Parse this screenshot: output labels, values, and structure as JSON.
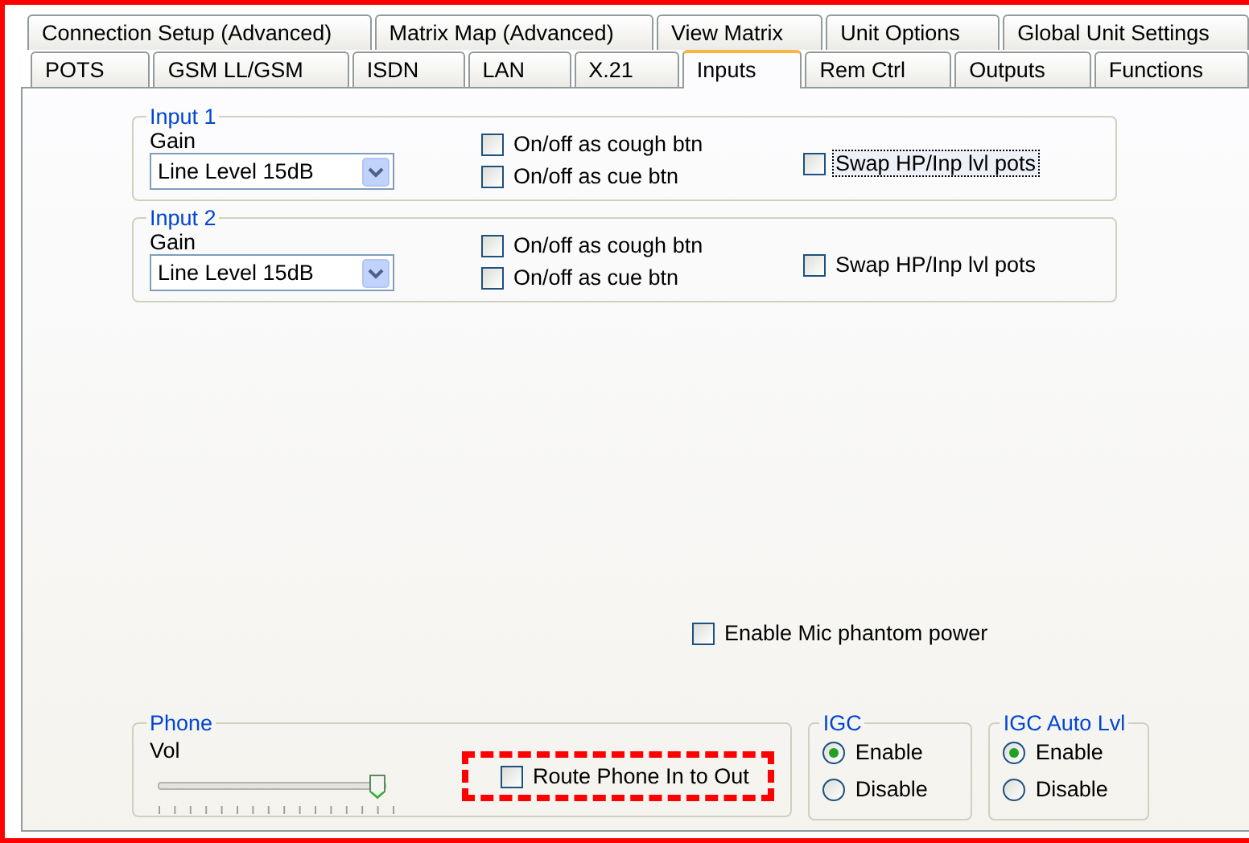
{
  "tab_rows": [
    [
      {
        "label": "Connection Setup (Advanced)",
        "selected": false
      },
      {
        "label": "Matrix Map (Advanced)",
        "selected": false
      },
      {
        "label": "View Matrix",
        "selected": false
      },
      {
        "label": "Unit Options",
        "selected": false
      },
      {
        "label": "Global Unit Settings",
        "selected": false
      }
    ],
    [
      {
        "label": "POTS",
        "selected": false
      },
      {
        "label": "GSM LL/GSM",
        "selected": false
      },
      {
        "label": "ISDN",
        "selected": false
      },
      {
        "label": "LAN",
        "selected": false
      },
      {
        "label": "X.21",
        "selected": false
      },
      {
        "label": "Inputs",
        "selected": true
      },
      {
        "label": "Rem Ctrl",
        "selected": false
      },
      {
        "label": "Outputs",
        "selected": false
      },
      {
        "label": "Functions",
        "selected": false
      }
    ]
  ],
  "input_groups": [
    {
      "title": "Input 1",
      "gain_label": "Gain",
      "gain_value": "Line Level 15dB",
      "checkboxes": [
        {
          "label": "On/off as cough btn",
          "checked": false
        },
        {
          "label": "On/off as cue btn",
          "checked": false
        }
      ],
      "swap": {
        "label": "Swap HP/Inp lvl pots",
        "checked": false,
        "focused": true
      }
    },
    {
      "title": "Input 2",
      "gain_label": "Gain",
      "gain_value": "Line Level 15dB",
      "checkboxes": [
        {
          "label": "On/off as cough btn",
          "checked": false
        },
        {
          "label": "On/off as cue btn",
          "checked": false
        }
      ],
      "swap": {
        "label": "Swap HP/Inp lvl pots",
        "checked": false,
        "focused": false
      }
    }
  ],
  "phantom": {
    "label": "Enable Mic phantom power",
    "checked": false
  },
  "phone": {
    "title": "Phone",
    "vol_label": "Vol",
    "level": 0.97,
    "route": {
      "label": "Route Phone In to Out",
      "checked": false,
      "highlighted": true
    }
  },
  "radio_groups": [
    {
      "title": "IGC",
      "options": [
        {
          "label": "Enable",
          "selected": true
        },
        {
          "label": "Disable",
          "selected": false
        }
      ]
    },
    {
      "title": "IGC Auto Lvl",
      "options": [
        {
          "label": "Enable",
          "selected": true
        },
        {
          "label": "Disable",
          "selected": false
        }
      ]
    }
  ]
}
